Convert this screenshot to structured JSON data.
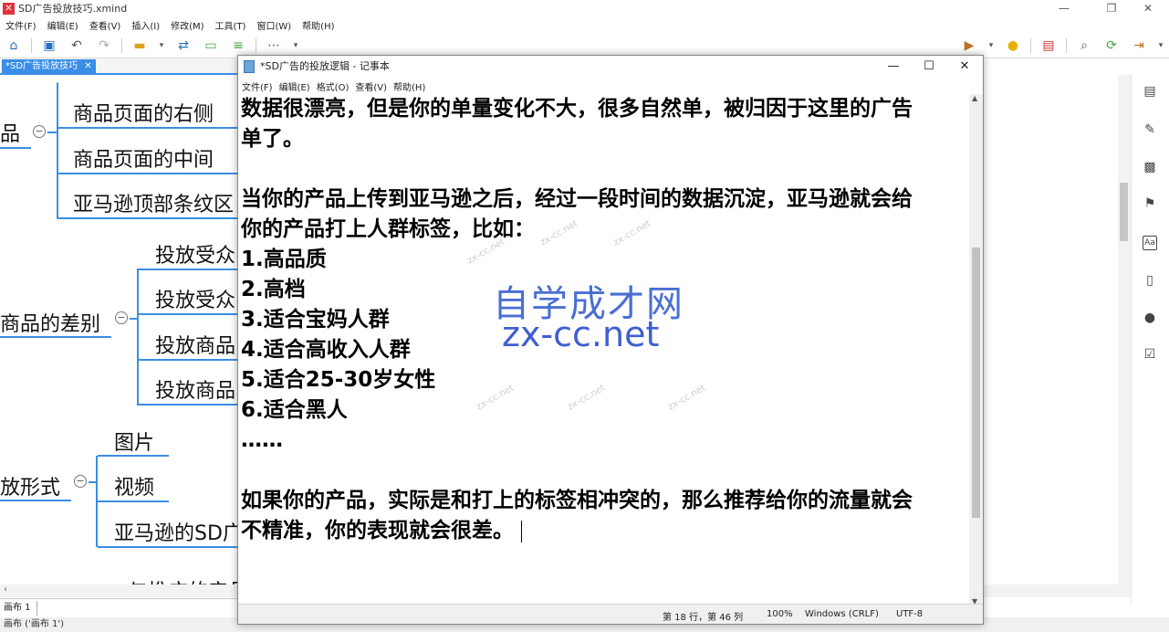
{
  "xmind": {
    "title": "SD广告投放技巧.xmind",
    "menu": [
      "文件(F)",
      "编辑(E)",
      "查看(V)",
      "插入(I)",
      "修改(M)",
      "工具(T)",
      "窗口(W)",
      "帮助(H)"
    ],
    "tab_label": "*SD广告投放技巧",
    "sheet_tab": "画布 1",
    "status": "画布 ('画布 1')",
    "topics": {
      "t1": "品",
      "t1_a": "商品页面的右侧",
      "t1_b": "商品页面的中间",
      "t1_c": "亚马逊顶部条纹区",
      "t2": "商品的差别",
      "t2_a": "投放受众",
      "t2_b": "投放受众",
      "t2_c": "投放商品",
      "t2_d": "投放商品",
      "t3": "放形式",
      "t3_a": "图片",
      "t3_b": "视频",
      "t3_c": "亚马逊的SD广",
      "t4": "与推广的产品"
    }
  },
  "notepad": {
    "title": "*SD广告的投放逻辑 - 记事本",
    "menu": [
      "文件(F)",
      "编辑(E)",
      "格式(O)",
      "查看(V)",
      "帮助(H)"
    ],
    "lines": [
      "数据很漂亮，但是你的单量变化不大，很多自然单，被归因于这里的广告",
      "单了。",
      "",
      "当你的产品上传到亚马逊之后，经过一段时间的数据沉淀，亚马逊就会给",
      "你的产品打上人群标签，比如：",
      "1.高品质",
      "2.高档",
      "3.适合宝妈人群",
      "4.适合高收入人群",
      "5.适合25-30岁女性",
      "6.适合黑人",
      "……",
      "",
      "如果你的产品，实际是和打上的标签相冲突的，那么推荐给你的流量就会",
      "不精准，你的表现就会很差。"
    ],
    "status": {
      "position": "第 18 行，第 46 列",
      "zoom": "100%",
      "eol": "Windows (CRLF)",
      "encoding": "UTF-8"
    }
  },
  "watermark": {
    "cn": "自学成才网",
    "en": "zx-cc.net"
  }
}
